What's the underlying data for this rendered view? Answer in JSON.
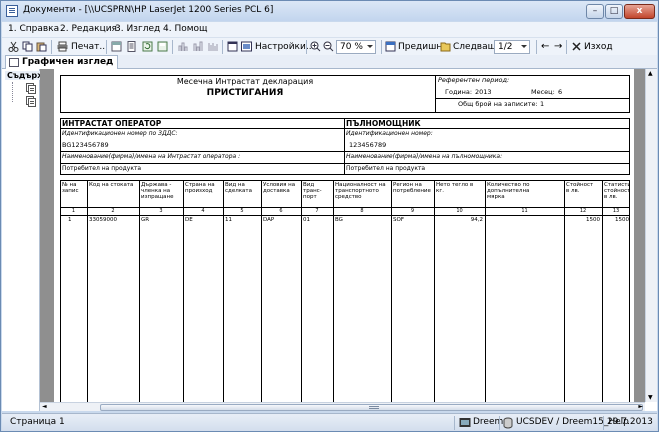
{
  "window": {
    "title": "Документи - [\\\\UCSPRN\\HP LaserJet 1200 Series PCL 6]",
    "min": "–",
    "max": "□",
    "close": "x"
  },
  "menu": [
    "1. Справка",
    "2. Редакция",
    "3. Изглед",
    "4. Помощ"
  ],
  "toolbar": {
    "print_label": "Печат...",
    "settings_label": "Настройки...",
    "zoom_value": "70 %",
    "prev_label": "Предишна",
    "next_label": "Следваща",
    "page_value": "1/2",
    "exit_label": "Изход"
  },
  "tab": {
    "label": "Графичен изглед"
  },
  "side_panel": {
    "title": "Съдърж"
  },
  "document": {
    "title": "Месечна Интрастат декларация",
    "subtitle": "ПРИСТИГАНИЯ",
    "ref_period_label": "Референтен период:",
    "year_label": "Година:",
    "year_value": "2013",
    "month_label": "Месец:",
    "month_value": "6",
    "records_label": "Общ брой на записите:",
    "records_value": "1",
    "operator_heading": "ИНТРАСТАТ ОПЕРАТОР",
    "agent_heading": "ПЪЛНОМОЩНИК",
    "operator_id_label": "Идентификационен номер по ЗДДС:",
    "operator_id_value": "BG123456789",
    "agent_id_label": "Идентификационен номер:",
    "agent_id_value": "123456789",
    "operator_name_label": "Наименование(фирма)/имена на Интрастат оператора :",
    "agent_name_label": "Наименование(фирма)/имена на пълномощника:",
    "operator_name_value": "Потребител на продукта",
    "agent_name_value": "Потребител на продукта",
    "columns": [
      {
        "label": "№ на запис",
        "num": "1"
      },
      {
        "label": "Код на стоката",
        "num": "2"
      },
      {
        "label": "Държава - членка на изпращане",
        "num": "3"
      },
      {
        "label": "Страна на произход",
        "num": "4"
      },
      {
        "label": "Вид на сделката",
        "num": "5"
      },
      {
        "label": "Условия на доставка",
        "num": "6"
      },
      {
        "label": "Вид транс- порт",
        "num": "7"
      },
      {
        "label": "Националност на транспортното средство",
        "num": "8"
      },
      {
        "label": "Регион на потребление",
        "num": "9"
      },
      {
        "label": "Нето тегло в кг.",
        "num": "10"
      },
      {
        "label": "Количество по допълнителна мярка",
        "num": "11"
      },
      {
        "label": "Стойност в лв.",
        "num": "12"
      },
      {
        "label": "Статистическа стойност в лв.",
        "num": "13"
      }
    ],
    "rows": [
      [
        "1",
        "33059000",
        "GR",
        "DE",
        "11",
        "DAP",
        "01",
        "BG",
        "SOF",
        "94,2",
        "",
        "1500",
        "1500"
      ]
    ]
  },
  "status": {
    "page": "Страница 1",
    "user": "Dreem",
    "server": "UCSDEV / Dreem15_Help",
    "date": "29.7.2013"
  }
}
